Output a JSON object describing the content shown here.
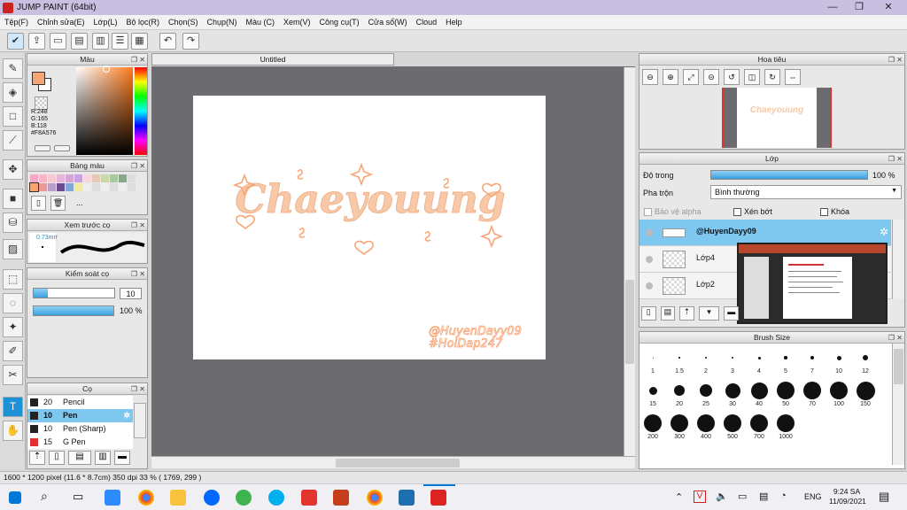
{
  "window": {
    "title": "JUMP PAINT (64bit)",
    "minimize": "—",
    "restore": "❐",
    "close": "✕"
  },
  "menu": [
    "Tệp(F)",
    "Chỉnh sửa(E)",
    "Lớp(L)",
    "Bộ lọc(R)",
    "Chọn(S)",
    "Chụp(N)",
    "Màu (C)",
    "Xem(V)",
    "Công cụ(T)",
    "Cửa sổ(W)",
    "Cloud",
    "Help"
  ],
  "document": {
    "tab": "Untitled",
    "artwork_title": "Chaeyouung",
    "artwork_credit_1": "@HuyenDayy09",
    "artwork_credit_2": "#HoiDap247",
    "accent": "#F8A576"
  },
  "color_panel": {
    "title": "Màu",
    "r": "R:248",
    "g": "G:165",
    "b": "B:118",
    "hex": "#F8A576"
  },
  "palette_panel": {
    "title": "Bảng màu",
    "more": "..."
  },
  "brush_preview": {
    "title": "Xem trước cọ",
    "size": "0.73mm"
  },
  "brush_control": {
    "title": "Kiểm soát cọ",
    "size": "10",
    "opacity": "100 %"
  },
  "brush_list": {
    "title": "Cọ",
    "items": [
      {
        "size": "20",
        "name": "Pencil",
        "color": "#222222"
      },
      {
        "size": "10",
        "name": "Pen",
        "color": "#222222",
        "selected": true
      },
      {
        "size": "10",
        "name": "Pen (Sharp)",
        "color": "#222222"
      },
      {
        "size": "15",
        "name": "G Pen",
        "color": "#e03030"
      }
    ]
  },
  "navigator": {
    "title": "Hoa tiêu"
  },
  "layers": {
    "title": "Lớp",
    "opacity_label": "Độ trong",
    "opacity_value": "100 %",
    "blend_label": "Pha trộn",
    "blend_value": "Bình thường",
    "protect_alpha": "Bảo vệ alpha",
    "clip": "Xén bớt",
    "lock": "Khóa",
    "items": [
      {
        "name": "@HuyenDayy09",
        "selected": true
      },
      {
        "name": "Lớp4"
      },
      {
        "name": "Lớp2"
      }
    ]
  },
  "brush_size": {
    "title": "Brush Size",
    "sizes": [
      "1",
      "1.5",
      "2",
      "3",
      "4",
      "5",
      "7",
      "10",
      "12",
      "15",
      "20",
      "25",
      "30",
      "40",
      "50",
      "70",
      "100",
      "150",
      "200",
      "300",
      "400",
      "500",
      "700",
      "1000"
    ]
  },
  "status": {
    "text": "1600 * 1200 pixel   (11.6 * 8.7cm)   350 dpi   33 %   ( 1769, 299 )"
  },
  "taskbar": {
    "lang": "ENG",
    "time": "9:24 SA",
    "date": "11/09/2021"
  }
}
